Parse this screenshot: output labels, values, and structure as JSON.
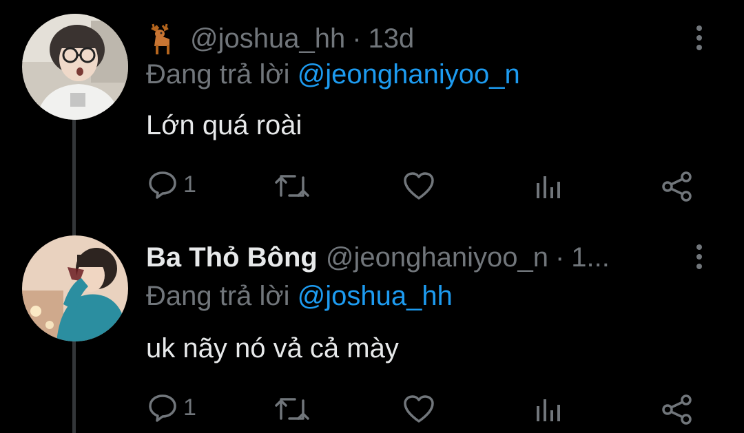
{
  "tweets": [
    {
      "display_name": "",
      "handle": "@joshua_hh",
      "separator": "·",
      "time": "13d",
      "reply_prefix": "Đang trả lời",
      "reply_to": "@jeonghaniyoo_n",
      "text": "Lớn quá roài",
      "reply_count": "1"
    },
    {
      "display_name": "Ba Thỏ Bông",
      "handle": "@jeonghaniyoo_n",
      "separator": "·",
      "time": "1...",
      "reply_prefix": "Đang trả lời",
      "reply_to": "@joshua_hh",
      "text": "uk nãy nó vả cả mày",
      "reply_count": "1"
    }
  ],
  "icons": {
    "reply": "speech-bubble-icon",
    "retweet": "retweet-icon",
    "like": "heart-icon",
    "views": "bar-chart-icon",
    "share": "share-icon",
    "more": "vertical-dots-icon",
    "name_emoji": "deer-emoji-icon"
  },
  "colors": {
    "background": "#000000",
    "text": "#e7e9ea",
    "muted": "#71767b",
    "link": "#1d9bf0",
    "thread_line": "#333639"
  }
}
